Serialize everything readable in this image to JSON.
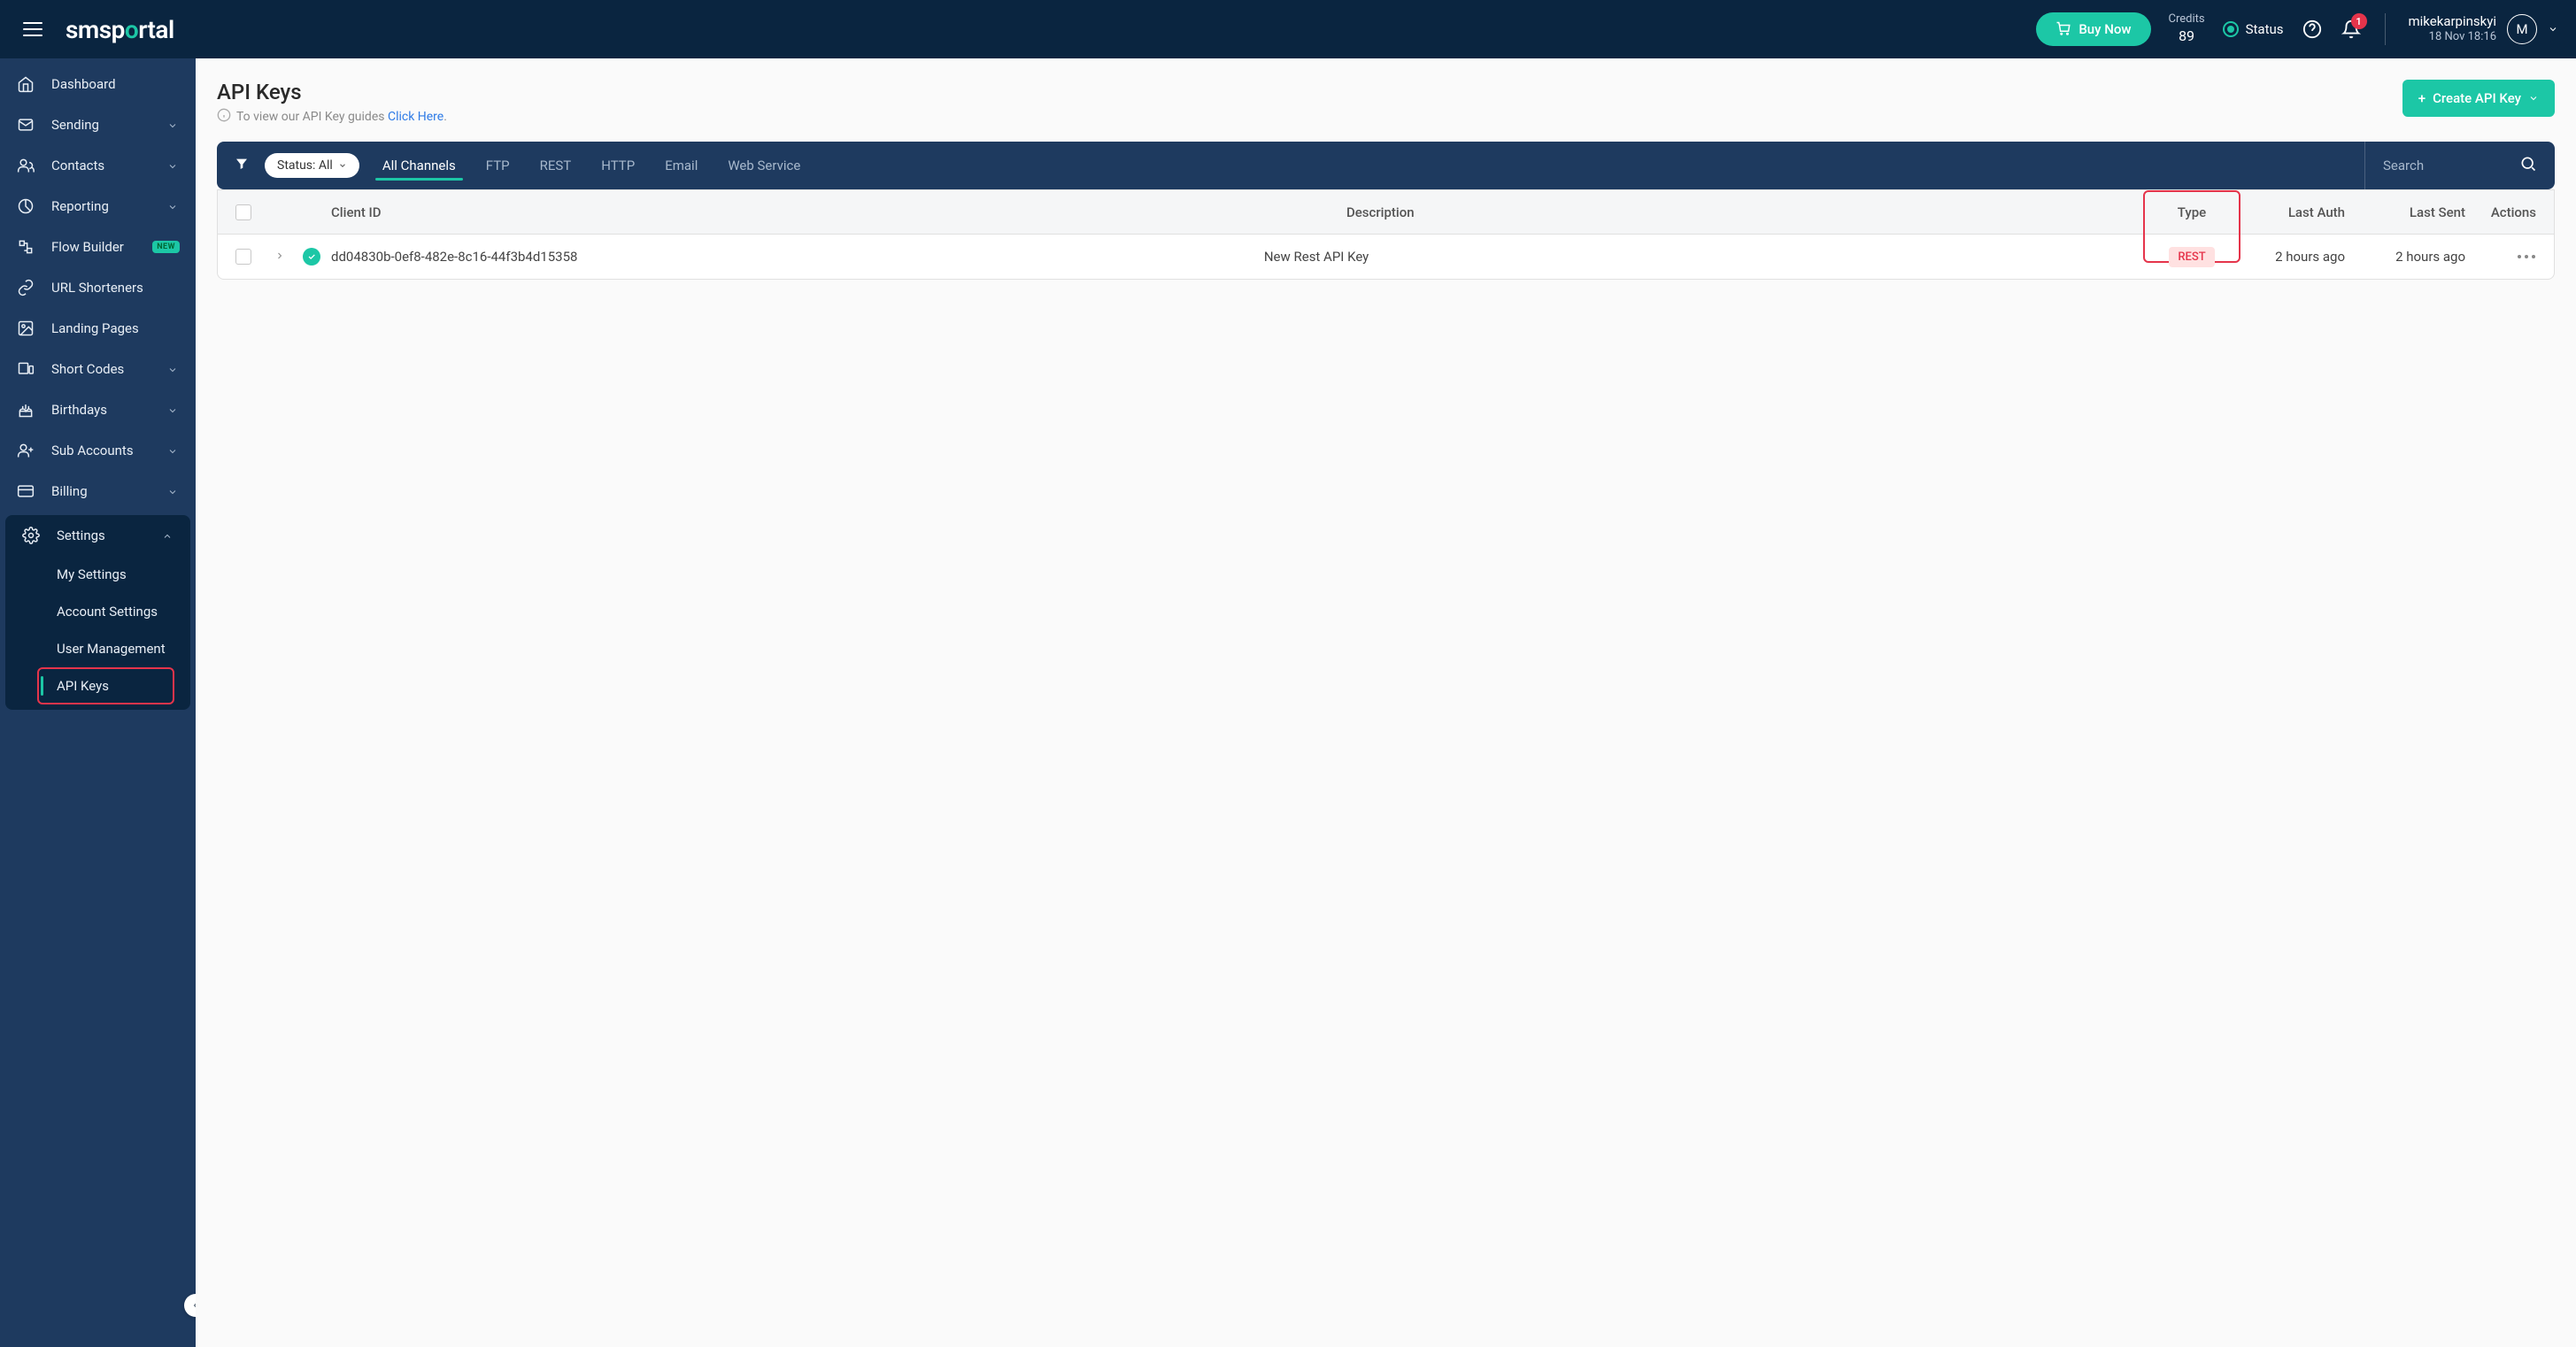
{
  "header": {
    "logo_pre": "smsp",
    "logo_accent": "o",
    "logo_post": "rtal",
    "buy_label": "Buy Now",
    "credits_label": "Credits",
    "credits_value": "89",
    "status_label": "Status",
    "notif_count": "1",
    "user_name": "mikekarpinskyi",
    "user_date": "18 Nov 18:16",
    "avatar_initial": "M"
  },
  "sidebar": {
    "items": [
      {
        "label": "Dashboard",
        "chev": false
      },
      {
        "label": "Sending",
        "chev": true
      },
      {
        "label": "Contacts",
        "chev": true
      },
      {
        "label": "Reporting",
        "chev": true
      },
      {
        "label": "Flow Builder",
        "chev": false,
        "badge": "NEW"
      },
      {
        "label": "URL Shorteners",
        "chev": false
      },
      {
        "label": "Landing Pages",
        "chev": false
      },
      {
        "label": "Short Codes",
        "chev": true
      },
      {
        "label": "Birthdays",
        "chev": true
      },
      {
        "label": "Sub Accounts",
        "chev": true
      },
      {
        "label": "Billing",
        "chev": true
      }
    ],
    "settings_label": "Settings",
    "sub_items": [
      {
        "label": "My Settings"
      },
      {
        "label": "Account Settings"
      },
      {
        "label": "User Management"
      },
      {
        "label": "API Keys",
        "active": true
      }
    ]
  },
  "page": {
    "title": "API Keys",
    "sub_text": "To view our API Key guides ",
    "sub_link": "Click Here",
    "sub_period": ".",
    "create_label": "Create API Key"
  },
  "filter": {
    "status_pill": "Status: All",
    "tabs": [
      "All Channels",
      "FTP",
      "REST",
      "HTTP",
      "Email",
      "Web Service"
    ],
    "search_placeholder": "Search"
  },
  "table": {
    "headers": {
      "client_id": "Client ID",
      "description": "Description",
      "type": "Type",
      "last_auth": "Last Auth",
      "last_sent": "Last Sent",
      "actions": "Actions"
    },
    "rows": [
      {
        "client_id": "dd04830b-0ef8-482e-8c16-44f3b4d15358",
        "description": "New Rest API Key",
        "type": "REST",
        "last_auth": "2 hours ago",
        "last_sent": "2 hours ago"
      }
    ]
  }
}
